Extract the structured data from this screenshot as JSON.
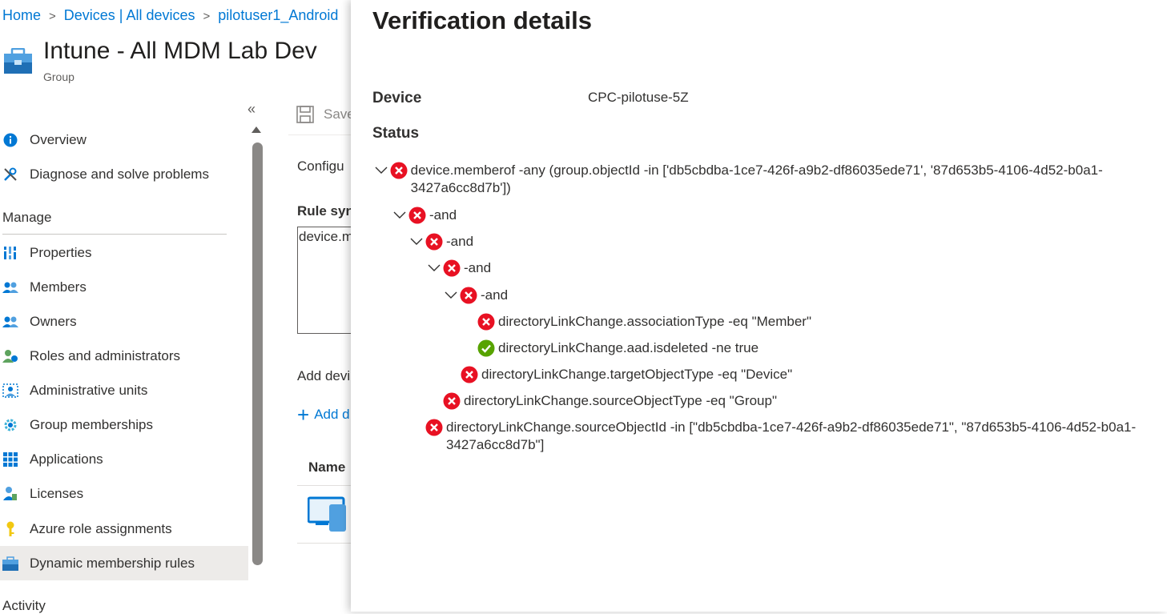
{
  "breadcrumb": {
    "home": "Home",
    "devices": "Devices | All devices",
    "current": "pilotuser1_Android"
  },
  "page": {
    "title": "Intune - All MDM Lab Dev",
    "subtitle": "Group"
  },
  "sidebar": {
    "collapse_icon": "«",
    "items": [
      {
        "label": "Overview",
        "icon": "info-icon"
      },
      {
        "label": "Diagnose and solve problems",
        "icon": "wrench-icon"
      }
    ],
    "manage_heading": "Manage",
    "manage_items": [
      {
        "label": "Properties",
        "icon": "properties-icon"
      },
      {
        "label": "Members",
        "icon": "members-icon"
      },
      {
        "label": "Owners",
        "icon": "owners-icon"
      },
      {
        "label": "Roles and administrators",
        "icon": "roles-icon"
      },
      {
        "label": "Administrative units",
        "icon": "admin-units-icon"
      },
      {
        "label": "Group memberships",
        "icon": "gear-icon"
      },
      {
        "label": "Applications",
        "icon": "grid-icon"
      },
      {
        "label": "Licenses",
        "icon": "licenses-icon"
      },
      {
        "label": "Azure role assignments",
        "icon": "key-icon"
      },
      {
        "label": "Dynamic membership rules",
        "icon": "toolbox-icon",
        "active": true
      }
    ],
    "activity_heading": "Activity"
  },
  "main": {
    "save_label": "Save",
    "configure_label": "Configu",
    "rule_syntax_label": "Rule syn",
    "rule_text": "device.m",
    "add_devices_label": "Add devi",
    "add_link_label": "Add d",
    "name_column": "Name"
  },
  "panel": {
    "title": "Verification details",
    "device_label": "Device",
    "device_value": "CPC-pilotuse-5Z",
    "status_label": "Status",
    "colors": {
      "fail": "#e81123",
      "pass": "#57a300"
    },
    "tree": [
      {
        "text": "device.memberof -any (group.objectId -in ['db5cbdba-1ce7-426f-a9b2-df86035ede71', '87d653b5-4106-4d52-b0a1-3427a6cc8d7b'])",
        "status": "fail",
        "expandable": true
      },
      {
        "text": "-and",
        "status": "fail",
        "expandable": true
      },
      {
        "text": "-and",
        "status": "fail",
        "expandable": true
      },
      {
        "text": "-and",
        "status": "fail",
        "expandable": true
      },
      {
        "text": "-and",
        "status": "fail",
        "expandable": true
      },
      {
        "text": "directoryLinkChange.associationType -eq \"Member\"",
        "status": "fail",
        "expandable": false
      },
      {
        "text": "directoryLinkChange.aad.isdeleted -ne true",
        "status": "pass",
        "expandable": false
      },
      {
        "text": "directoryLinkChange.targetObjectType -eq \"Device\"",
        "status": "fail",
        "expandable": false
      },
      {
        "text": "directoryLinkChange.sourceObjectType -eq \"Group\"",
        "status": "fail",
        "expandable": false
      },
      {
        "text": "directoryLinkChange.sourceObjectId -in [\"db5cbdba-1ce7-426f-a9b2-df86035ede71\", \"87d653b5-4106-4d52-b0a1-3427a6cc8d7b\"]",
        "status": "fail",
        "expandable": false
      }
    ]
  }
}
